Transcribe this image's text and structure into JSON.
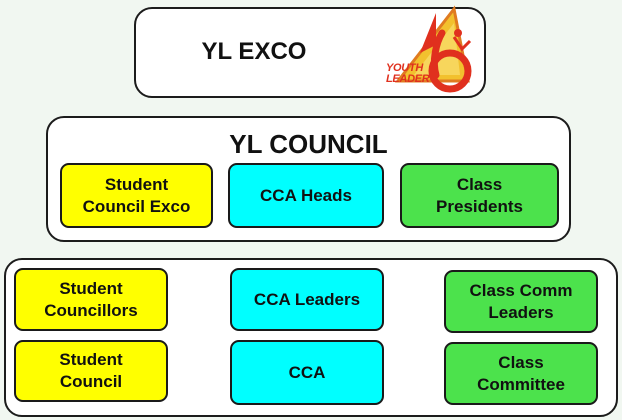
{
  "exco": {
    "title": "YL EXCO",
    "logo": {
      "icon": "youth-leader-logo",
      "line1": "YOUTH",
      "line2": "LEADER"
    }
  },
  "council": {
    "title": "YL COUNCIL",
    "items": [
      {
        "label": "Student\nCouncil Exco",
        "color": "#ffff00"
      },
      {
        "label": "CCA Heads",
        "color": "#00ffff"
      },
      {
        "label": "Class\nPresidents",
        "color": "#4ce24c"
      }
    ]
  },
  "base": {
    "columns": [
      {
        "items": [
          {
            "label": "Student\nCouncillors",
            "color": "#ffff00"
          },
          {
            "label": "Student\nCouncil",
            "color": "#ffff00"
          }
        ]
      },
      {
        "items": [
          {
            "label": "CCA Leaders",
            "color": "#00ffff"
          },
          {
            "label": "CCA",
            "color": "#00ffff"
          }
        ]
      },
      {
        "items": [
          {
            "label": "Class Comm\nLeaders",
            "color": "#4ce24c"
          },
          {
            "label": "Class\nCommittee",
            "color": "#4ce24c"
          }
        ]
      }
    ]
  }
}
